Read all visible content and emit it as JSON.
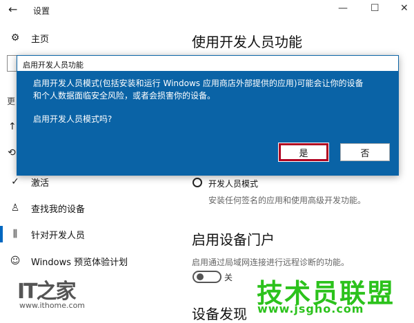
{
  "window": {
    "title": "设置",
    "back_icon": "←",
    "minimize": "—",
    "maximize": "☐",
    "close": "✕"
  },
  "sidebar": {
    "home_label": "主页",
    "partial_section": "更",
    "items": [
      {
        "label": "激活",
        "icon": "activation-icon"
      },
      {
        "label": "查找我的设备",
        "icon": "person-icon"
      },
      {
        "label": "针对开发人员",
        "icon": "developer-icon",
        "selected": true
      },
      {
        "label": "Windows 预览体验计划",
        "icon": "insider-icon"
      }
    ]
  },
  "main": {
    "heading": "使用开发人员功能",
    "dev_mode_label": "开发人员模式",
    "dev_mode_desc": "安装任何签名的应用和使用高级开发功能。",
    "portal_heading": "启用设备门户",
    "portal_desc": "启用通过局域网连接进行远程诊断的功能。",
    "portal_toggle_label": "关",
    "discovery_heading": "设备发现"
  },
  "dialog": {
    "title": "启用开发人员功能",
    "message_line1": "启用开发人员模式(包括安装和运行 Windows 应用商店外部提供的应用)可能会让你的设备",
    "message_line2": "和个人数据面临安全风险，或者会损害你的设备。",
    "question": "启用开发人员模式吗?",
    "yes_label": "是",
    "no_label": "否"
  },
  "watermarks": {
    "ithome_logo": "IT之家",
    "ithome_url": "www.ithome.com",
    "jsgho_text": "技术员联盟",
    "jsgho_url": "www.jsgho.com"
  },
  "colors": {
    "dialog_bg": "#0a63a6",
    "accent": "#0067c0",
    "highlight_border": "#b00020",
    "watermark_green": "#2cc21c"
  }
}
